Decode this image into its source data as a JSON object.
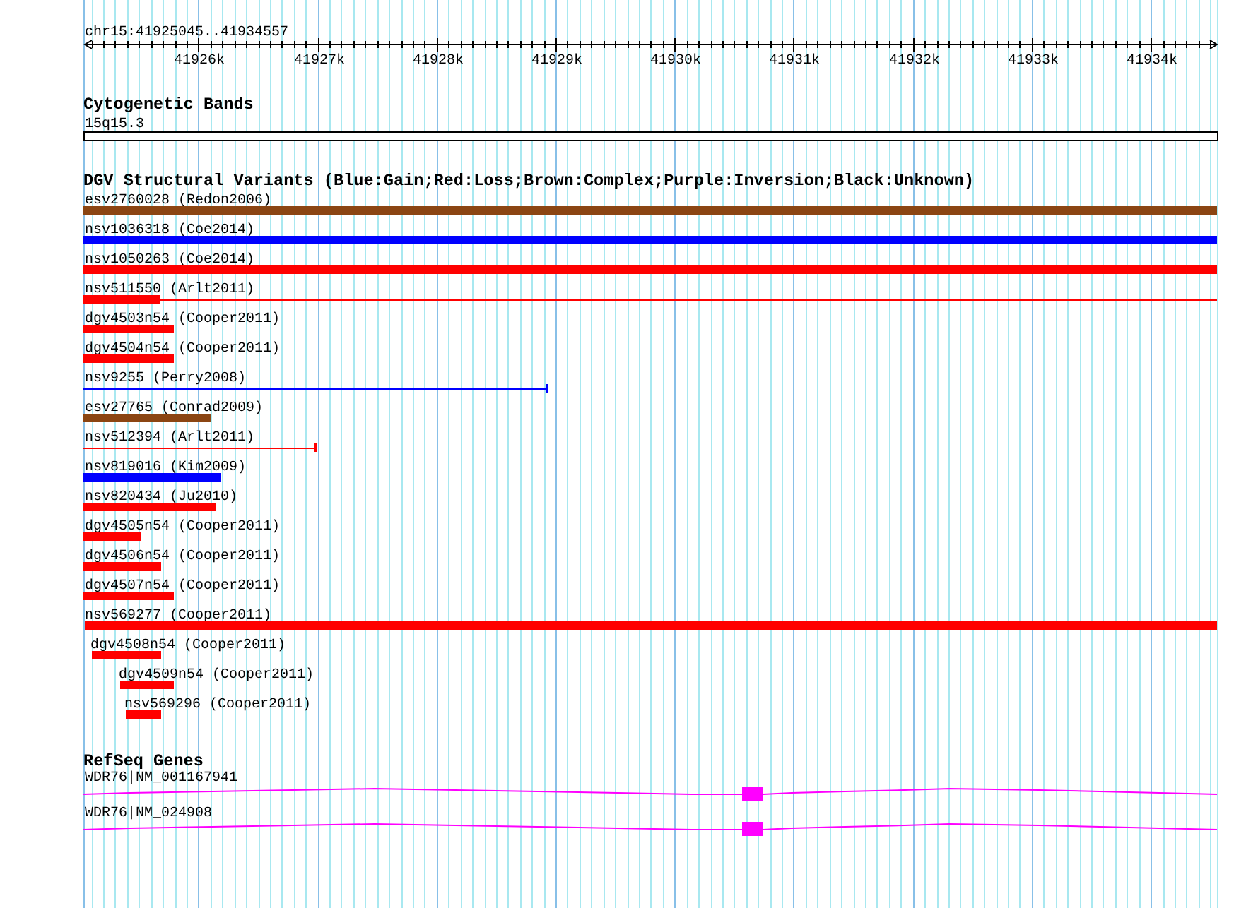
{
  "ruler": {
    "title": "chr15:41925045..41934557",
    "ticks": [
      "41926k",
      "41927k",
      "41928k",
      "41929k",
      "41930k",
      "41931k",
      "41932k",
      "41933k",
      "41934k"
    ]
  },
  "tracks": [
    {
      "kind": "cytoband",
      "title": "Cytogenetic Bands",
      "features": [
        {
          "label": "15q15.3"
        }
      ]
    },
    {
      "kind": "variants",
      "title": "DGV Structural Variants (Blue:Gain;Red:Loss;Brown:Complex;Purple:Inversion;Black:Unknown)",
      "features": [
        {
          "label": "esv2760028 (Redon2006)",
          "kind": "bar",
          "color": "#8b4513"
        },
        {
          "label": "nsv1036318 (Coe2014)",
          "kind": "bar",
          "color": "#0000ff"
        },
        {
          "label": "nsv1050263 (Coe2014)",
          "kind": "bar",
          "color": "#ff0000"
        },
        {
          "label": "nsv511550 (Arlt2011)",
          "kind": "bar_line",
          "color": "#ff0000"
        },
        {
          "label": "dgv4503n54 (Cooper2011)",
          "kind": "bar",
          "color": "#ff0000"
        },
        {
          "label": "dgv4504n54 (Cooper2011)",
          "kind": "bar",
          "color": "#ff0000"
        },
        {
          "label": "nsv9255 (Perry2008)",
          "kind": "line",
          "color": "#0000ff"
        },
        {
          "label": "esv27765 (Conrad2009)",
          "kind": "bar",
          "color": "#8b4513"
        },
        {
          "label": "nsv512394 (Arlt2011)",
          "kind": "line",
          "color": "#ff0000"
        },
        {
          "label": "nsv819016 (Kim2009)",
          "kind": "bar",
          "color": "#0000ff"
        },
        {
          "label": "nsv820434 (Ju2010)",
          "kind": "bar",
          "color": "#ff0000"
        },
        {
          "label": "dgv4505n54 (Cooper2011)",
          "kind": "bar",
          "color": "#ff0000"
        },
        {
          "label": "dgv4506n54 (Cooper2011)",
          "kind": "bar",
          "color": "#ff0000"
        },
        {
          "label": "dgv4507n54 (Cooper2011)",
          "kind": "bar",
          "color": "#ff0000"
        },
        {
          "label": "nsv569277 (Cooper2011)",
          "kind": "bar",
          "color": "#ff0000"
        },
        {
          "label": "dgv4508n54 (Cooper2011)",
          "kind": "bar",
          "color": "#ff0000"
        },
        {
          "label": "dgv4509n54 (Cooper2011)",
          "kind": "bar",
          "color": "#ff0000"
        },
        {
          "label": "nsv569296 (Cooper2011)",
          "kind": "bar",
          "color": "#ff0000"
        }
      ]
    },
    {
      "kind": "genes",
      "title": "RefSeq Genes",
      "features": [
        {
          "label": "WDR76|NM_001167941"
        },
        {
          "label": "WDR76|NM_024908"
        }
      ]
    }
  ]
}
